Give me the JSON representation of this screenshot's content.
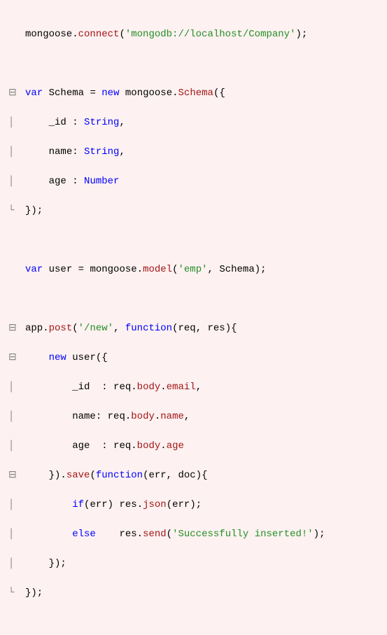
{
  "lines": {
    "l1_obj": "mongoose",
    "l1_method": "connect",
    "l1_str": "'mongodb://localhost/Company'",
    "l3_kw": "var",
    "l3_var": "Schema",
    "l3_new": "new",
    "l3_obj": "mongoose",
    "l3_method": "Schema",
    "l4_prop": "_id",
    "l4_type": "String",
    "l5_prop": "name",
    "l5_type": "String",
    "l6_prop": "age",
    "l6_type": "Number",
    "l9_kw": "var",
    "l9_var": "user",
    "l9_obj": "mongoose",
    "l9_method": "model",
    "l9_str": "'emp'",
    "l9_arg": "Schema",
    "l11_obj": "app",
    "l11_method": "post",
    "l11_str": "'/new'",
    "l11_fn": "function",
    "l11_args": "req, res",
    "l12_new": "new",
    "l12_user": "user",
    "l13_prop": "_id",
    "l13_val_a": "req",
    "l13_val_b": "body",
    "l13_val_c": "email",
    "l14_prop": "name",
    "l14_val_a": "req",
    "l14_val_b": "body",
    "l14_val_c": "name",
    "l15_prop": "age",
    "l15_val_a": "req",
    "l15_val_b": "body",
    "l15_val_c": "age",
    "l16_method": "save",
    "l16_fn": "function",
    "l16_args": "err, doc",
    "l17_if": "if",
    "l17_cond": "err",
    "l17_obj": "res",
    "l17_method": "json",
    "l17_arg": "err",
    "l18_else": "else",
    "l18_obj": "res",
    "l18_method": "send",
    "l18_str": "'Successfully inserted!'"
  }
}
